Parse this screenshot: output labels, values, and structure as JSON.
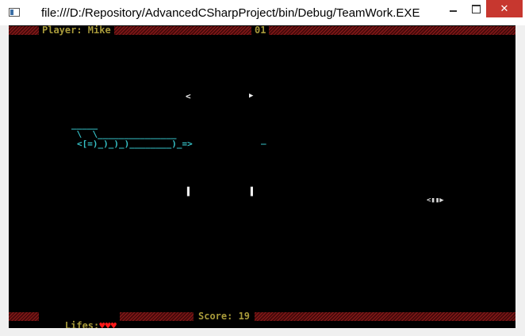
{
  "window": {
    "title": "file:///D:/Repository/AdvancedCSharpProject/bin/Debug/TeamWork.EXE",
    "close_glyph": "✕"
  },
  "hud": {
    "player_label": "Player: Mike",
    "level": "01",
    "lives_label": "Lifes:",
    "lives_hearts": "♥♥♥",
    "score_label": "Score: 19"
  },
  "sprites": {
    "ship_line1": "_____",
    "ship_line2": " \\  \\_______________",
    "ship_line3": "<[=)_)_)_)________)_=>",
    "enemy_dash": "_",
    "bullet_left_top": "<",
    "bullet_right_top": "▶",
    "bullet_left_bottom": "▌",
    "bullet_right_bottom": "▌",
    "enemy_right": "<▮▮▶"
  },
  "colors": {
    "console_bg": "#000000",
    "hud_text": "#a89a3a",
    "ship": "#36c2c8",
    "hearts": "#ff1a1a",
    "close_button": "#c7372f"
  }
}
